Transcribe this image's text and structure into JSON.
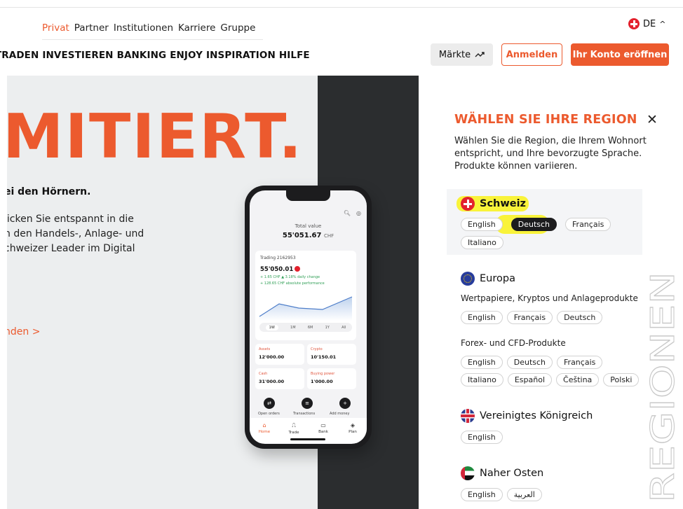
{
  "header": {
    "top_nav": [
      "Privat",
      "Partner",
      "Institutionen",
      "Karriere",
      "Gruppe"
    ],
    "active_top_nav": "Privat",
    "language": "DE",
    "main_nav": [
      "TRADEN",
      "INVESTIEREN",
      "BANKING",
      "ENJOY",
      "INSPIRATION",
      "HILFE"
    ],
    "markets_label": "Märkte",
    "login_label": "Anmelden",
    "open_account_label": "Ihr Konto eröffnen"
  },
  "hero": {
    "title": "MITIERT.",
    "subtitle": "ei den Hörnern.",
    "desc_lines": [
      "licken Sie entspannt in die",
      "n den Handels-, Anlage- und",
      "chweizer Leader im Digital"
    ],
    "link": "nden  >"
  },
  "phone": {
    "total_label": "Total value",
    "total_value": "55'051.67",
    "currency": "CHF",
    "trading_label": "Trading 2162953",
    "trading_value": "55'050.01",
    "daily_change": "+ 1.65 CHF  ▲ 3.18% daily change",
    "abs_perf": "+ 128.65 CHF absolute performance",
    "periods": [
      "1W",
      "1M",
      "6M",
      "1Y",
      "All"
    ],
    "selected_period": "1W",
    "tiles": [
      {
        "label": "Assets",
        "value": "12'000.00"
      },
      {
        "label": "Crypto",
        "value": "10'150.01"
      },
      {
        "label": "Cash",
        "value": "31'000.00"
      },
      {
        "label": "Buying power",
        "value": "1'000.00"
      }
    ],
    "actions": [
      "Open orders",
      "Transactions",
      "Add money"
    ],
    "tabs": [
      "Home",
      "Trade",
      "Bank",
      "Plan"
    ]
  },
  "region_panel": {
    "title": "WÄHLEN SIE IHRE REGION",
    "description": "Wählen Sie die Region, die Ihrem Wohnort entspricht, und Ihre bevorzugte Sprache. Produkte können variieren.",
    "vertical_text": "REGIONEN",
    "regions": [
      {
        "name": "Schweiz",
        "languages": [
          "English",
          "Deutsch",
          "Français",
          "Italiano"
        ],
        "selected": "Deutsch"
      },
      {
        "name": "Europa",
        "groups": [
          {
            "label": "Wertpapiere, Kryptos und Anlageprodukte",
            "languages": [
              "English",
              "Français",
              "Deutsch"
            ]
          },
          {
            "label": "Forex- und CFD-Produkte",
            "languages": [
              "English",
              "Deutsch",
              "Français",
              "Italiano",
              "Español",
              "Čeština",
              "Polski"
            ]
          }
        ]
      },
      {
        "name": "Vereinigtes Königreich",
        "languages": [
          "English"
        ]
      },
      {
        "name": "Naher Osten",
        "languages": [
          "English",
          "العربية"
        ]
      }
    ]
  },
  "colors": {
    "accent": "#ec5a2e",
    "highlight": "#f9f33a",
    "dark": "#2b2d2f"
  }
}
